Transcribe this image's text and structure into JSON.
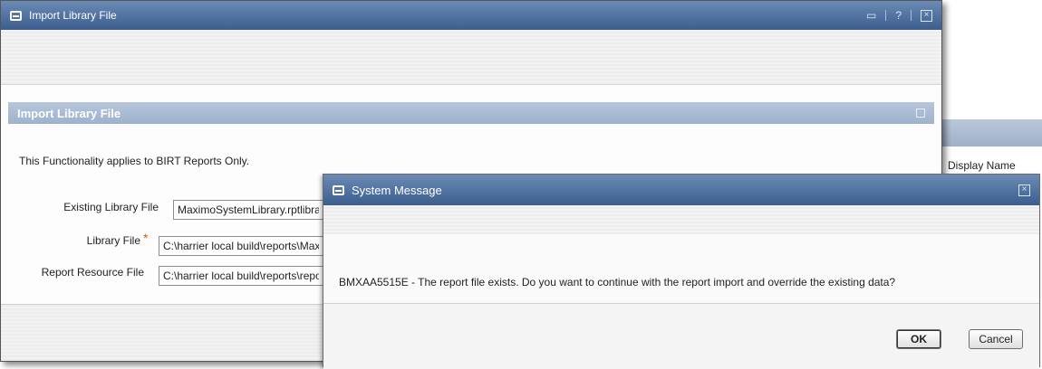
{
  "background": {
    "column_header": "Display Name"
  },
  "import_dialog": {
    "title": "Import Library File",
    "controls": {
      "help": "?",
      "close": "☒"
    },
    "section_title": "Import Library File",
    "intro_text": "This Functionality applies to BIRT Reports Only.",
    "fields": {
      "existing_library_label": "Existing Library File",
      "existing_library_value": "MaximoSystemLibrary.rptlibrary",
      "library_file_label": "Library File",
      "library_file_required": "*",
      "library_file_value": "C:\\harrier local build\\reports\\MaximoSystemLibrary.rptlibrary",
      "resource_file_label": "Report Resource File",
      "resource_file_value": "C:\\harrier local build\\reports\\reports.properties"
    }
  },
  "system_message": {
    "title": "System Message",
    "close": "☒",
    "message": "BMXAA5515E - The report file exists. Do you want to continue with the report import and override the existing data?",
    "ok_label": "OK",
    "cancel_label": "Cancel"
  }
}
